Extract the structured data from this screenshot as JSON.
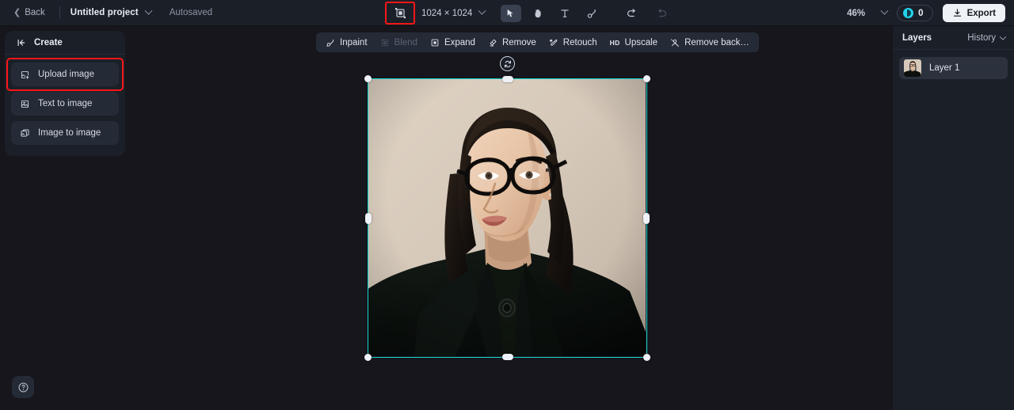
{
  "header": {
    "back_label": "Back",
    "project_name": "Untitled project",
    "autosaved_label": "Autosaved",
    "canvas_size": "1024 × 1024",
    "zoom_level": "46%",
    "credits_count": "0",
    "export_label": "Export",
    "tools": [
      {
        "name": "select-tool",
        "icon": "cursor-icon",
        "active": true
      },
      {
        "name": "pan-tool",
        "icon": "hand-icon",
        "active": false
      },
      {
        "name": "text-tool",
        "icon": "text-icon",
        "active": false
      },
      {
        "name": "brush-tool",
        "icon": "brush-icon",
        "active": false
      }
    ],
    "undo_label": "Undo",
    "redo_label": "Redo",
    "accent_cyan": "#22d3ee",
    "highlight_red": "#ff1616"
  },
  "sidebar": {
    "title": "Create",
    "items": [
      {
        "label": "Upload image",
        "icon": "upload-image-icon",
        "highlighted": true
      },
      {
        "label": "Text to image",
        "icon": "text-to-image-icon",
        "highlighted": false
      },
      {
        "label": "Image to image",
        "icon": "image-to-image-icon",
        "highlighted": false
      }
    ]
  },
  "canvas_toolbar": {
    "items": [
      {
        "label": "Inpaint",
        "icon": "inpaint-icon",
        "disabled": false
      },
      {
        "label": "Blend",
        "icon": "blend-icon",
        "disabled": true
      },
      {
        "label": "Expand",
        "icon": "expand-icon",
        "disabled": false
      },
      {
        "label": "Remove",
        "icon": "eraser-icon",
        "disabled": false
      },
      {
        "label": "Retouch",
        "icon": "retouch-icon",
        "disabled": false
      },
      {
        "label": "Upscale",
        "tag": "HD",
        "icon": "hd-icon",
        "disabled": false
      },
      {
        "label": "Remove back…",
        "icon": "remove-background-icon",
        "disabled": false
      }
    ]
  },
  "canvas": {
    "selection_color": "#17d6d0",
    "image_alt": "portrait of a woman wearing black round glasses and a black high-collar coat on a beige background"
  },
  "right_panel": {
    "layers_label": "Layers",
    "history_label": "History",
    "layers": [
      {
        "name": "Layer 1"
      }
    ]
  },
  "help": {
    "label": "Help"
  }
}
